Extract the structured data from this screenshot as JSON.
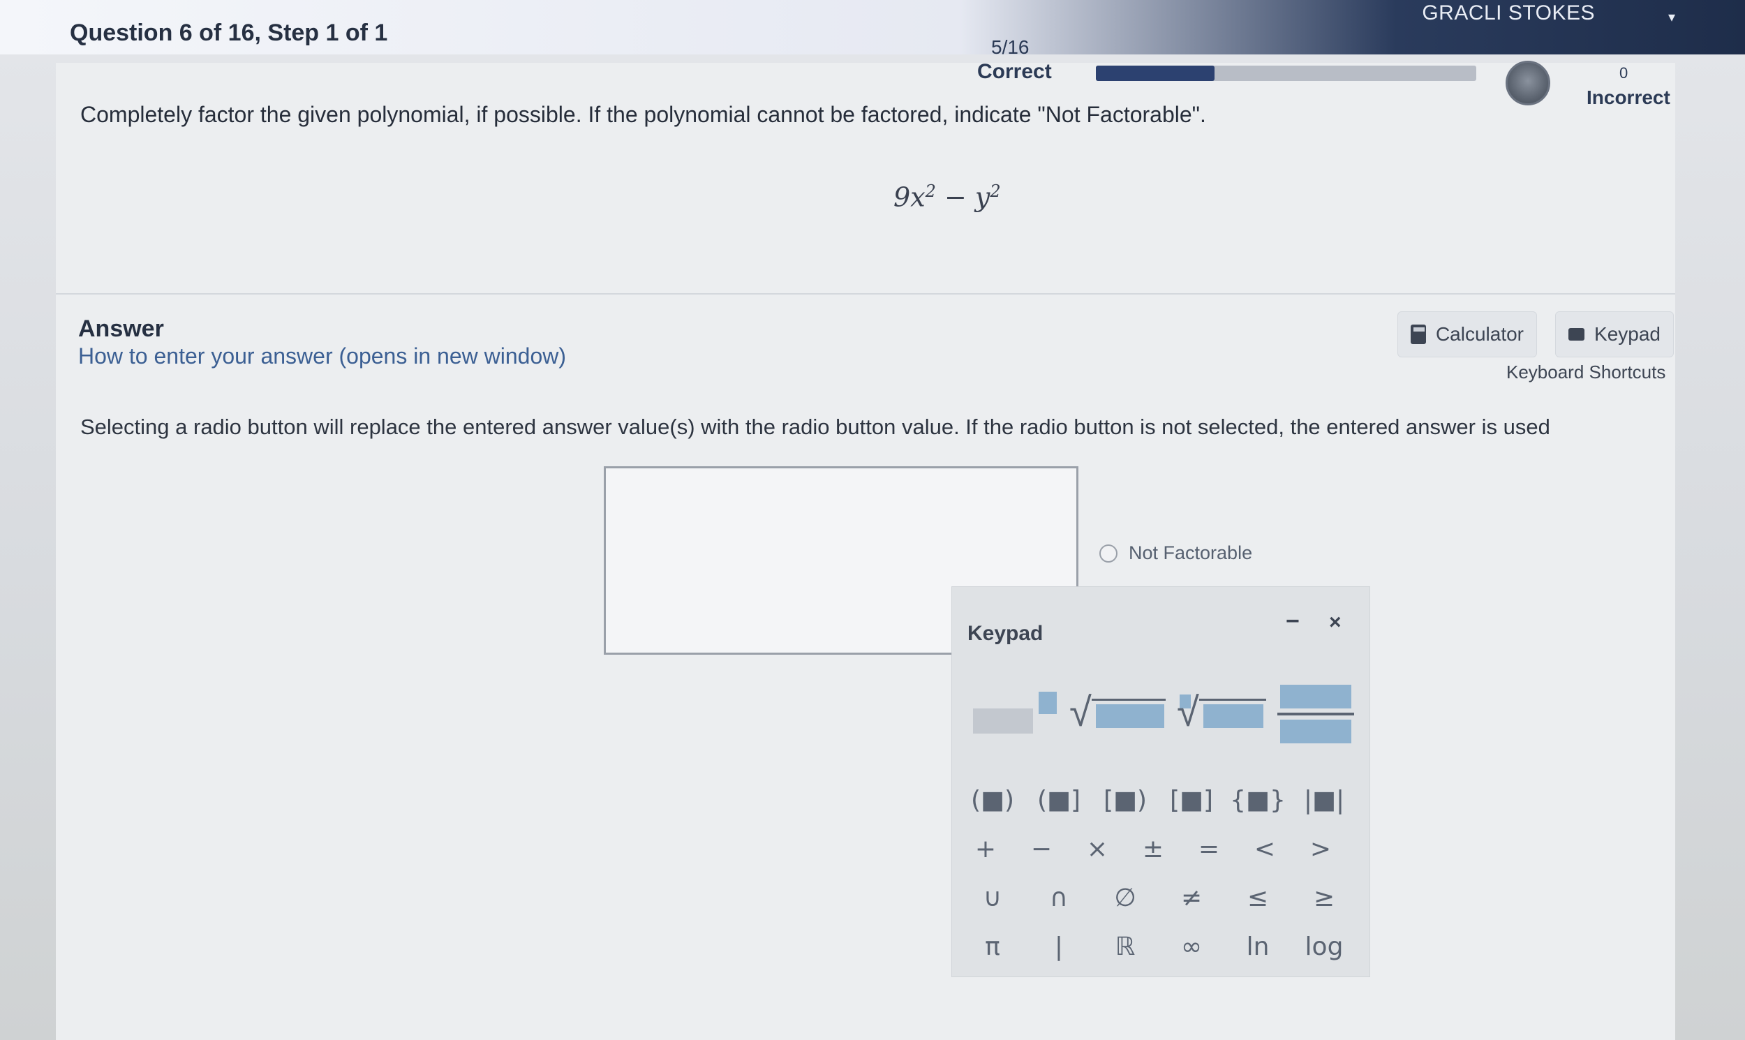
{
  "header": {
    "question_label": "Question 6 of 16,  Step 1 of 1",
    "score_fraction": "5/16",
    "correct_label": "Correct",
    "progress_fraction": 0.3125,
    "incorrect_count": "0",
    "incorrect_label": "Incorrect",
    "user_name": "GRACLI STOKES",
    "user_menu_icon": "caret-down-icon"
  },
  "question": {
    "instruction": "Completely factor the given polynomial, if possible. If the polynomial cannot be factored, indicate \"Not Factorable\".",
    "expression_coef": "9",
    "expression_var1": "x",
    "expression_exp1": "2",
    "expression_op": " − ",
    "expression_var2": "y",
    "expression_exp2": "2"
  },
  "answer": {
    "title": "Answer",
    "help_link": "How to enter your answer (opens in new window)",
    "calculator_label": "Calculator",
    "keypad_label": "Keypad",
    "shortcuts_label": "Keyboard Shortcuts",
    "radio_note": "Selecting a radio button will replace the entered answer value(s) with the radio button value. If the radio button is not selected, the entered answer is used",
    "input_value": "",
    "not_factorable_label": "Not Factorable"
  },
  "keypad": {
    "title": "Keypad",
    "minimize_label": "−",
    "close_label": "×",
    "templates": [
      "exponent",
      "square-root",
      "nth-root",
      "fraction"
    ],
    "row_brackets": [
      "(■)",
      "(■]",
      "[■)",
      "[■]",
      "{■}",
      "|■|"
    ],
    "row_ops": [
      "+",
      "−",
      "×",
      "±",
      "=",
      "<",
      ">"
    ],
    "row_sets": [
      "∪",
      "∩",
      "∅",
      "≠",
      "≤",
      "≥"
    ],
    "row_misc": [
      "π",
      "|",
      "ℝ",
      "∞",
      "ln",
      "log"
    ]
  },
  "colors": {
    "header_dark": "#1e2d4a",
    "progress_fill": "#2c4170",
    "link": "#3b5f93",
    "keypad_blue": "#8fb2cf"
  }
}
